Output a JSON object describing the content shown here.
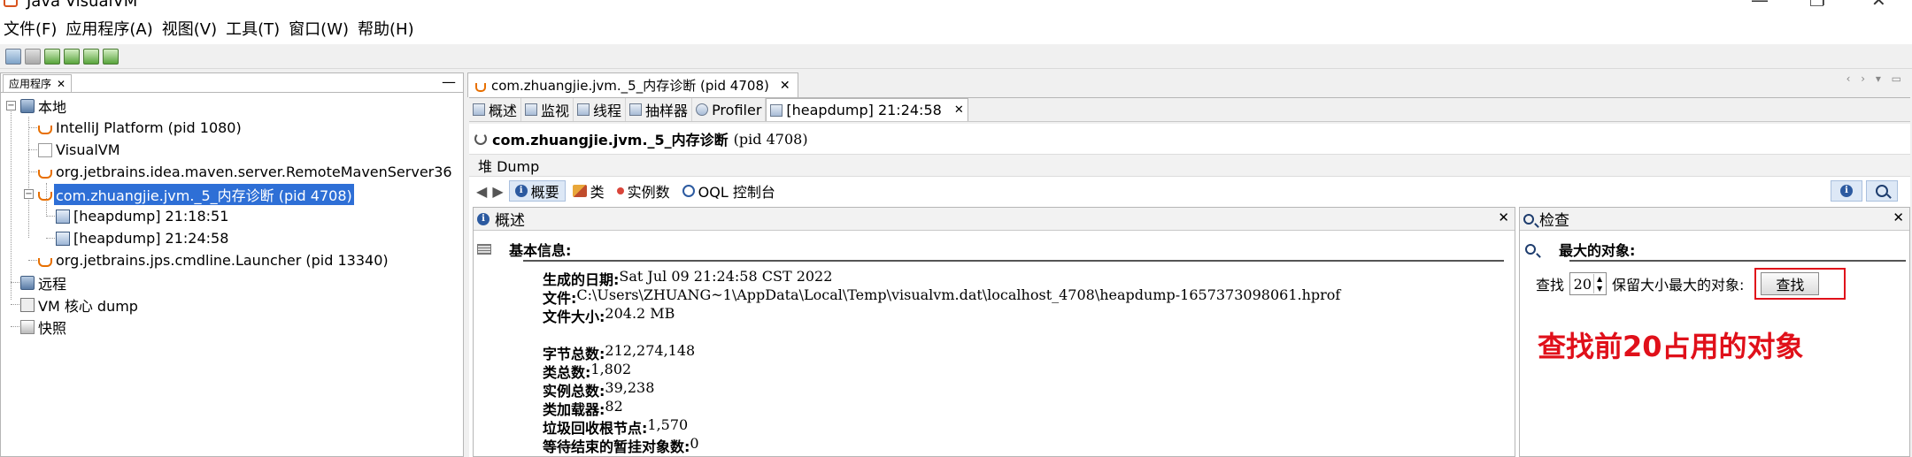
{
  "window": {
    "title": "Java VisualVM",
    "controls": {
      "minimize": "—",
      "maximize": "❐",
      "close": "✕"
    }
  },
  "menu": [
    "文件(F)",
    "应用程序(A)",
    "视图(V)",
    "工具(T)",
    "窗口(W)",
    "帮助(H)"
  ],
  "toolbar": {
    "icons": [
      "open-icon",
      "save-icon",
      "add-jmx-icon",
      "add-core-icon",
      "heap-dump-icon",
      "snapshot-icon"
    ]
  },
  "left_panel": {
    "tab_label": "应用程序",
    "tab_close": "✕",
    "minimize": "—",
    "tree": {
      "local": "本地",
      "local_items": [
        "IntelliJ Platform (pid 1080)",
        "VisualVM",
        "org.jetbrains.idea.maven.server.RemoteMavenServer36",
        "com.zhuangjie.jvm._5_内存诊断 (pid 4708)"
      ],
      "heapdumps": [
        "[heapdump] 21:18:51",
        "[heapdump] 21:24:58"
      ],
      "launcher": "org.jetbrains.jps.cmdline.Launcher (pid 13340)",
      "remote": "远程",
      "core_dump": "VM 核心 dump",
      "snapshots": "快照"
    }
  },
  "editor": {
    "doc_tab": "com.zhuangjie.jvm._5_内存诊断 (pid 4708)",
    "close_glyph": "✕",
    "subtabs": [
      "概述",
      "监视",
      "线程",
      "抽样器",
      "Profiler",
      "[heapdump] 21:24:58"
    ],
    "process_title": "com.zhuangjie.jvm._5_内存诊断",
    "process_pid": "(pid 4708)",
    "heap_dump_label": "堆 Dump",
    "views": [
      "概要",
      "类",
      "实例数",
      "OQL 控制台"
    ]
  },
  "overview": {
    "title": "概述",
    "section": "基本信息:",
    "lines": [
      {
        "k": "生成的日期:",
        "v": " Sat Jul 09 21:24:58 CST 2022"
      },
      {
        "k": "文件:",
        "v": " C:\\Users\\ZHUANG~1\\AppData\\Local\\Temp\\visualvm.dat\\localhost_4708\\heapdump-1657373098061.hprof"
      },
      {
        "k": "文件大小:",
        "v": " 204.2 MB"
      }
    ],
    "stats": [
      {
        "k": "字节总数:",
        "v": " 212,274,148"
      },
      {
        "k": "类总数:",
        "v": " 1,802"
      },
      {
        "k": "实例总数:",
        "v": " 39,238"
      },
      {
        "k": "类加载器:",
        "v": " 82"
      },
      {
        "k": "垃圾回收根节点:",
        "v": " 1,570"
      },
      {
        "k": "等待结束的暂挂对象数:",
        "v": " 0"
      }
    ]
  },
  "inspect": {
    "title": "检查",
    "section": "最大的对象:",
    "find_label": "查找",
    "count": "20",
    "suffix": "保留大小最大的对象:",
    "button": "查找",
    "annotation": "查找前20占用的对象",
    "annotation_color": "#e0101a"
  },
  "colors": {
    "selection": "#2e6fd6",
    "accent": "#2c5aa0"
  }
}
